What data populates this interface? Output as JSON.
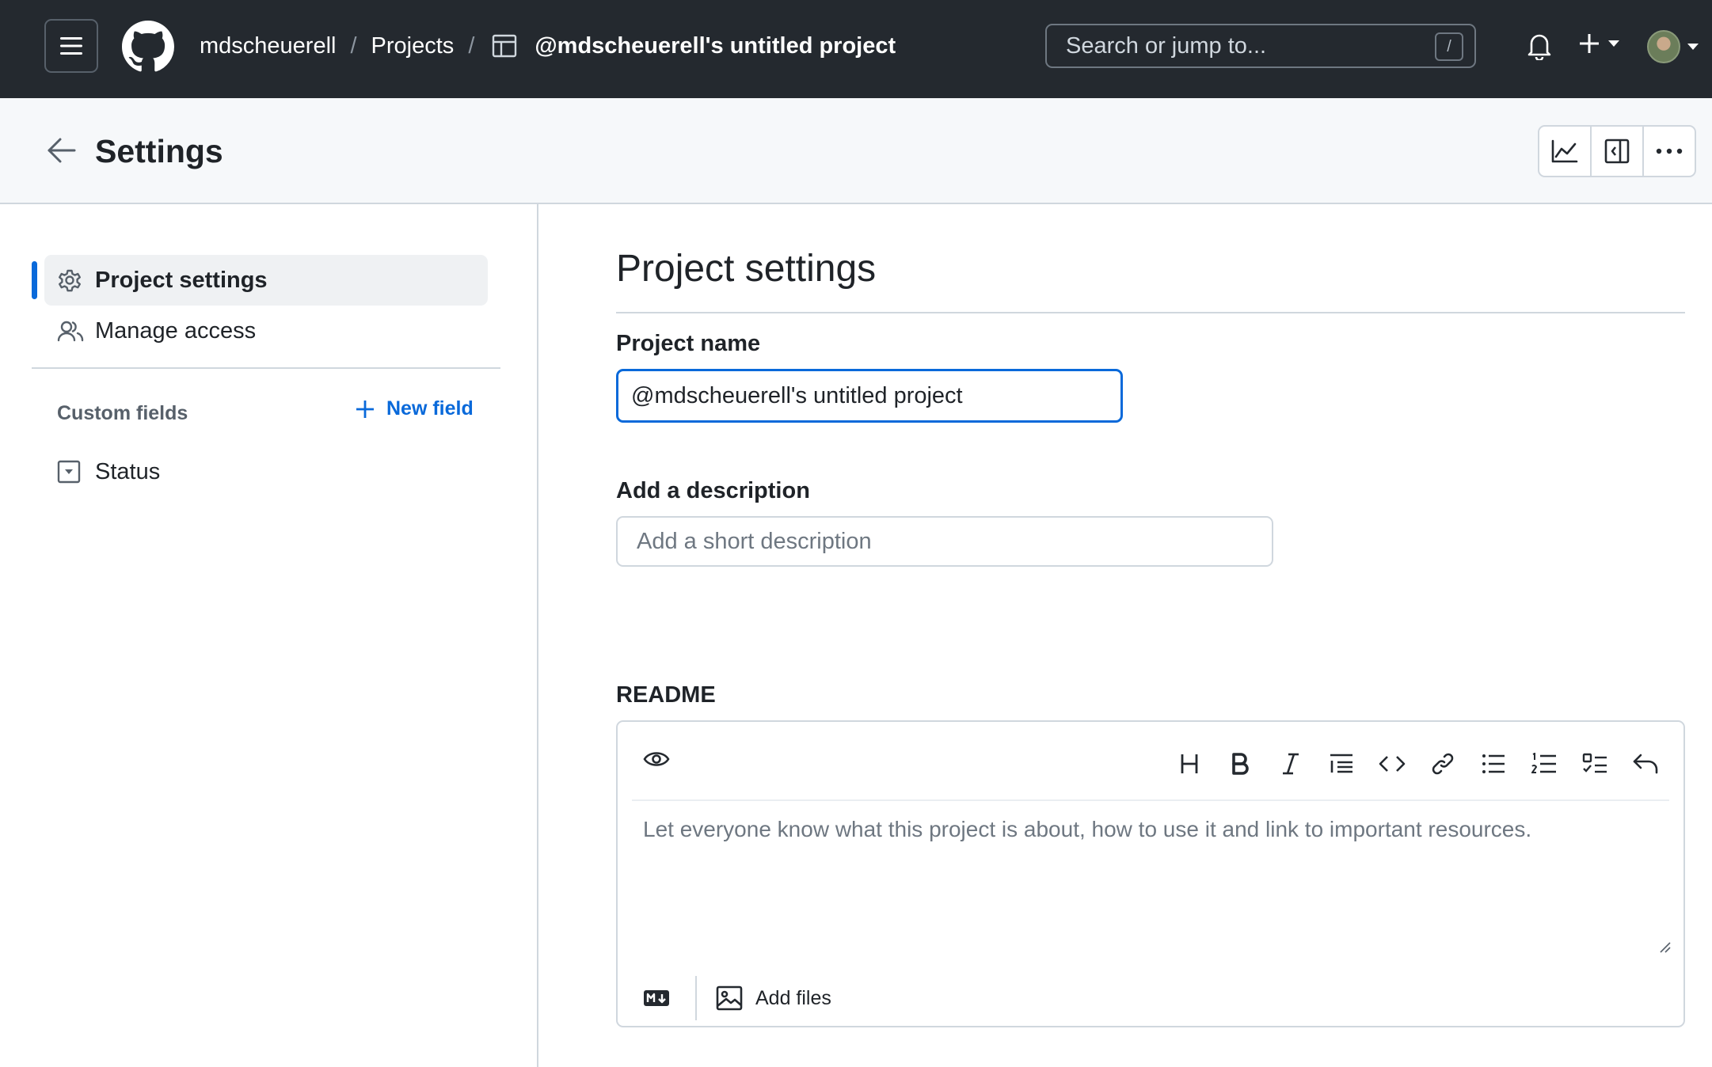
{
  "header": {
    "breadcrumbs": [
      {
        "label": "mdscheuerell"
      },
      {
        "label": "Projects"
      },
      {
        "label": "@mdscheuerell's untitled project"
      }
    ],
    "separator": "/",
    "search": {
      "placeholder": "Search or jump to...",
      "shortcut": "/"
    }
  },
  "subheader": {
    "title": "Settings"
  },
  "sidebar": {
    "items": [
      {
        "label": "Project settings",
        "icon": "gear-icon",
        "active": true
      },
      {
        "label": "Manage access",
        "icon": "people-icon",
        "active": false
      }
    ],
    "custom_fields": {
      "label": "Custom fields",
      "new_field_label": "New field",
      "fields": [
        {
          "label": "Status",
          "icon": "single-select-icon"
        }
      ]
    }
  },
  "main": {
    "title": "Project settings",
    "project_name": {
      "label": "Project name",
      "value": "@mdscheuerell's untitled project"
    },
    "description": {
      "label": "Add a description",
      "placeholder": "Add a short description"
    },
    "readme": {
      "label": "README",
      "placeholder": "Let everyone know what this project is about, how to use it and link to important resources.",
      "add_files_label": "Add files"
    }
  },
  "colors": {
    "header_bg": "#24292f",
    "accent": "#0969da",
    "border": "#d0d7de",
    "subheader_bg": "#f6f8fa"
  }
}
